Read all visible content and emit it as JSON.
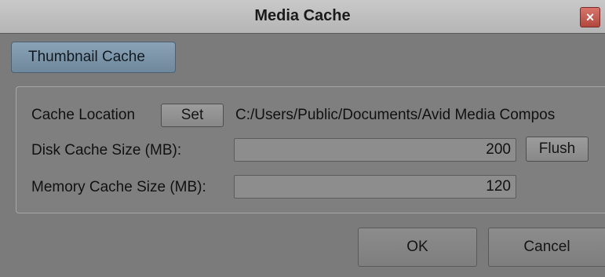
{
  "window": {
    "title": "Media Cache",
    "close_glyph": "×"
  },
  "tabs": [
    {
      "label": "Thumbnail Cache",
      "active": true
    }
  ],
  "cache": {
    "location_label": "Cache Location",
    "set_label": "Set",
    "location_path": "C:/Users/Public/Documents/Avid Media Compos",
    "disk_label": "Disk Cache Size (MB):",
    "disk_value": "200",
    "flush_label": "Flush",
    "memory_label": "Memory Cache Size (MB):",
    "memory_value": "120"
  },
  "actions": {
    "ok_label": "OK",
    "cancel_label": "Cancel"
  },
  "colors": {
    "active_tab": "#7d95a9",
    "close_button": "#c75a50",
    "background": "#7b7b7b"
  },
  "icons": {
    "close": "close-icon"
  }
}
